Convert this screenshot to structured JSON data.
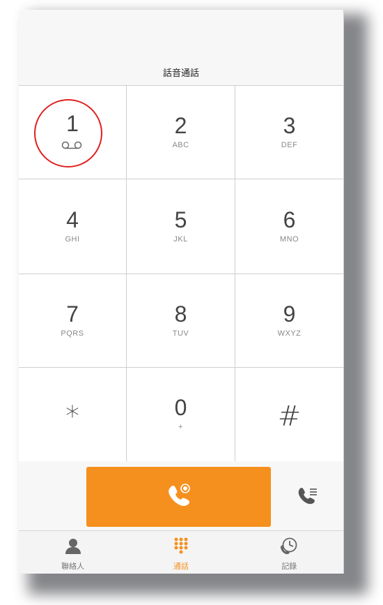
{
  "header": {
    "title": "話音通話"
  },
  "keypad": {
    "keys": [
      {
        "digit": "1",
        "letters": ""
      },
      {
        "digit": "2",
        "letters": "ABC"
      },
      {
        "digit": "3",
        "letters": "DEF"
      },
      {
        "digit": "4",
        "letters": "GHI"
      },
      {
        "digit": "5",
        "letters": "JKL"
      },
      {
        "digit": "6",
        "letters": "MNO"
      },
      {
        "digit": "7",
        "letters": "PQRS"
      },
      {
        "digit": "8",
        "letters": "TUV"
      },
      {
        "digit": "9",
        "letters": "WXYZ"
      },
      {
        "digit": "*",
        "letters": ""
      },
      {
        "digit": "0",
        "letters": "+"
      },
      {
        "digit": "#",
        "letters": ""
      }
    ]
  },
  "tabs": [
    {
      "label": "聯絡人",
      "icon": "contact-icon"
    },
    {
      "label": "通話",
      "icon": "keypad-icon"
    },
    {
      "label": "記錄",
      "icon": "history-icon"
    }
  ],
  "colors": {
    "accent": "#f5901e",
    "highlight": "#e02020"
  }
}
